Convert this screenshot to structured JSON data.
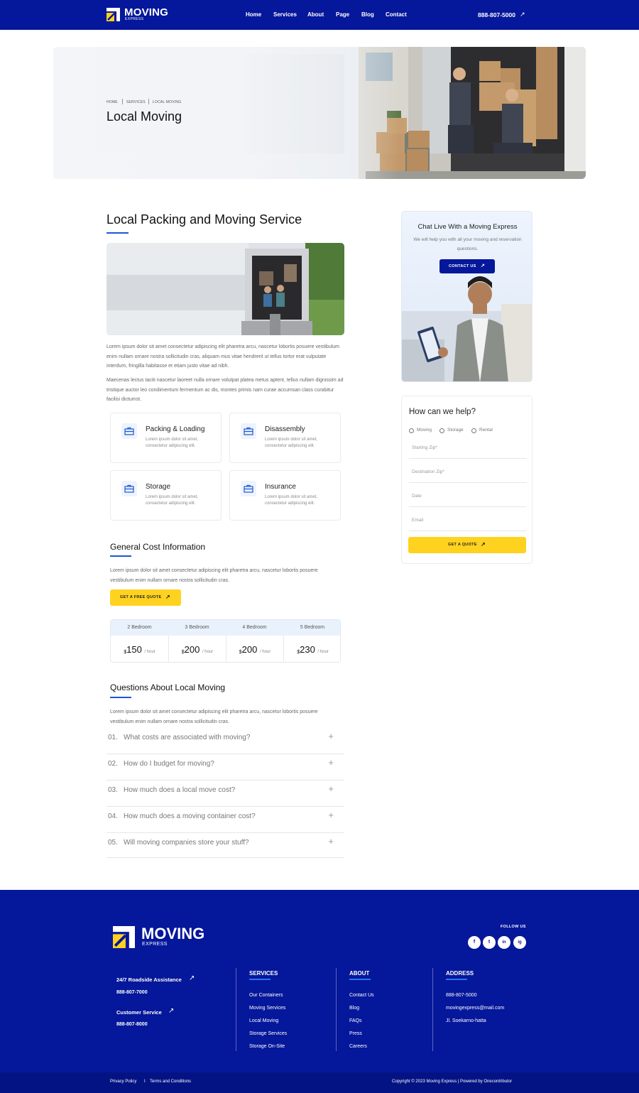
{
  "header": {
    "logo_title": "MOVING",
    "logo_sub": "EXPRESS",
    "nav": [
      "Home",
      "Services",
      "About",
      "Page",
      "Blog",
      "Contact"
    ],
    "phone": "888-807-5000",
    "phone_arrow": "↗",
    "brand_color": "#05179a"
  },
  "hero": {
    "breadcrumb": [
      "HOME",
      "SERVICES",
      "LOCAL MOVING"
    ],
    "title": "Local Moving"
  },
  "main": {
    "title": "Local Packing and Moving Service",
    "para1": "Lorem ipsum dolor sit amet consectetur adipiscing elit pharetra arcu, nascetur lobortis posuere vestibulum enim nullam ornare nostra sollicitudin cras, aliquam mus vitae hendrerit ut tellus tortor erat vulputate interdum, fringilla habitasse et etiam justo vitae ad nibh.",
    "para2": "Maecenas lectus taciti nascetur laoreet nulla ornare volutpat platea metus aptent, tellus nullam dignissim ad tristique auctor leo condimentum fermentum ac dis, montes primis nam curae accumsan class curabitur facilisi dictumst.",
    "services": [
      {
        "title": "Packing & Loading",
        "desc": "Lorem ipsum dolor sit amet, consectetur adipiscing elit."
      },
      {
        "title": "Disassembly",
        "desc": "Lorem ipsum dolor sit amet, consectetur adipiscing elit."
      },
      {
        "title": "Storage",
        "desc": "Lorem ipsum dolor sit amet, consectetur adipiscing elit."
      },
      {
        "title": "Insurance",
        "desc": "Lorem ipsum dolor sit amet, consectetur adipiscing elit."
      }
    ],
    "cost": {
      "title": "General Cost Information",
      "desc": "Lorem ipsum dolor sit amet consectetur adipiscing elit pharetra arcu, nascetur lobortis posuere vestibulum enim nullam ornare nostra sollicitudin cras.",
      "button": "GET A FREE QUOTE",
      "button_arrow": "↗",
      "currency": "$",
      "unit": "/ hour",
      "columns": [
        "2 Bedroom",
        "3 Bedroom",
        "4 Bedroom",
        "5 Bedroom"
      ],
      "prices": [
        "150",
        "200",
        "200",
        "230"
      ]
    },
    "faq": {
      "title": "Questions About Local Moving",
      "desc": "Lorem ipsum dolor sit amet consectetur adipiscing elit pharetra arcu, nascetur lobortis posuere vestibulum enim nullam ornare nostra sollicitudin cras.",
      "plus": "+",
      "items": [
        {
          "num": "01.",
          "q": "What costs are associated with moving?"
        },
        {
          "num": "02.",
          "q": "How do I budget for moving?"
        },
        {
          "num": "03.",
          "q": "How much does a local move cost?"
        },
        {
          "num": "04.",
          "q": "How much does a moving container cost?"
        },
        {
          "num": "05.",
          "q": "Will moving companies store your stuff?"
        }
      ]
    }
  },
  "sidebar": {
    "chat_title": "Chat Live With a Moving Express",
    "chat_desc": "We will help you with all your moving and reservation questions.",
    "chat_button": "CONTACT US",
    "chat_button_arrow": "↗",
    "form_title": "How can we help?",
    "radios": [
      "Moving",
      "Storage",
      "Rental"
    ],
    "fields": [
      "Starting Zip*",
      "Destination Zip*",
      "Date",
      "Email"
    ],
    "form_button": "GET A QUOTE",
    "form_button_arrow": "↗"
  },
  "footer": {
    "logo_title": "MOVING",
    "logo_sub": "EXPRESS",
    "follow": "FOLLOW US",
    "social": [
      "f",
      "t",
      "in",
      "ig"
    ],
    "roadside_label": "24/7 Roadside Assistance",
    "roadside_phone": "888-807-7000",
    "customer_label": "Customer Service",
    "customer_phone": "888-807-8000",
    "arrow": "↗",
    "services_head": "SERVICES",
    "services": [
      "Our Containers",
      "Moving Services",
      "Local Moving",
      "Storage Services",
      "Storage On-Site"
    ],
    "about_head": "ABOUT",
    "about": [
      "Contact Us",
      "Blog",
      "FAQs",
      "Press",
      "Careers"
    ],
    "address_head": "ADDRESS",
    "address": [
      "888-807-5000",
      "movingexpress@mail.com",
      "Jl. Soekarno-hatta"
    ],
    "privacy": "Privacy Policy",
    "sep": "I",
    "terms": "Terms and Conditions",
    "copyright": "Copyright © 2023 Moving Express | Powered by Onecontributor"
  }
}
